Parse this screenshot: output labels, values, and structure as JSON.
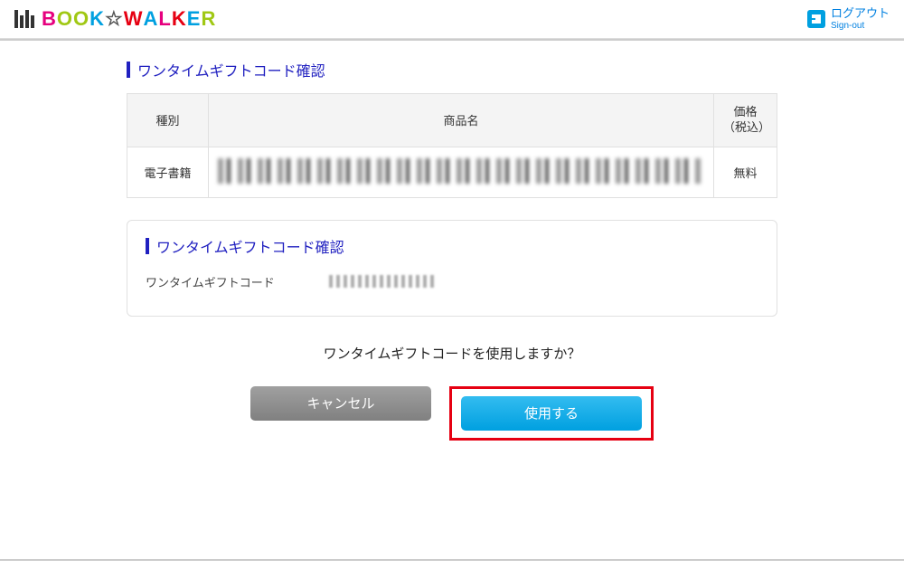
{
  "header": {
    "logo_alt": "BOOK☆WALKER",
    "signout": {
      "label": "ログアウト",
      "sub": "Sign-out"
    }
  },
  "page": {
    "title1": "ワンタイムギフトコード確認",
    "table": {
      "headers": {
        "type": "種別",
        "product": "商品名",
        "price": "価格\n（税込）"
      },
      "rows": [
        {
          "type": "電子書籍",
          "price": "無料"
        }
      ]
    },
    "panel": {
      "title": "ワンタイムギフトコード確認",
      "label_code": "ワンタイムギフトコード"
    },
    "confirm_text": "ワンタイムギフトコードを使用しますか？",
    "buttons": {
      "cancel": "キャンセル",
      "use": "使用する"
    }
  }
}
